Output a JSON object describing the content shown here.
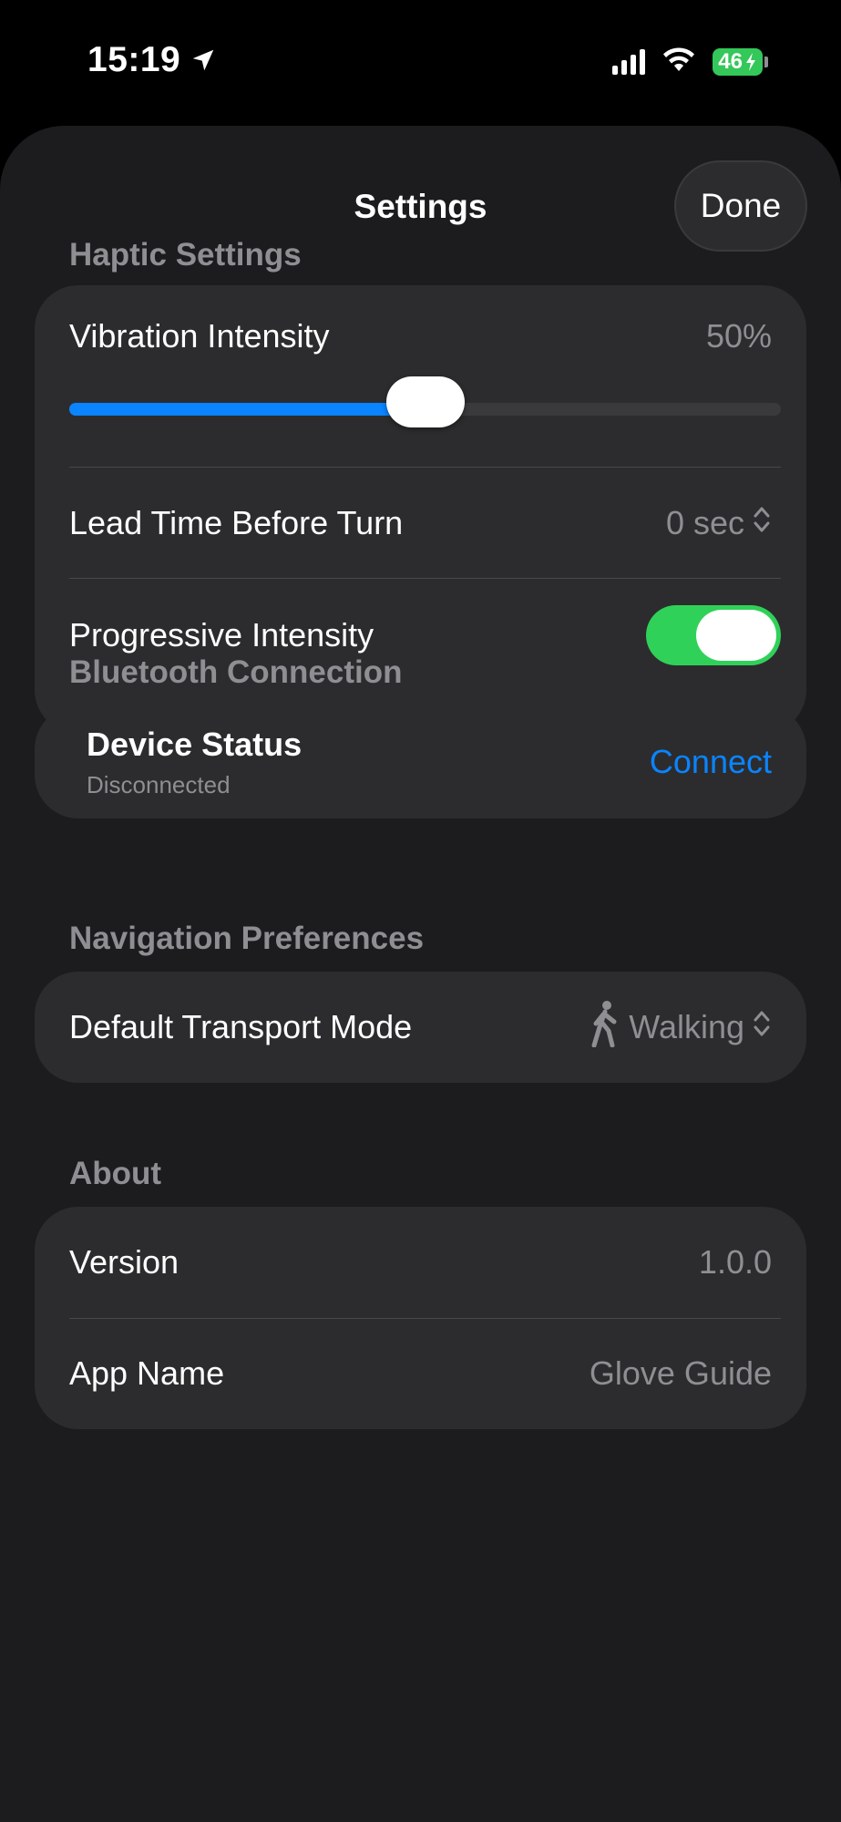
{
  "status_bar": {
    "time": "15:19",
    "battery": "46"
  },
  "header": {
    "title": "Settings",
    "done_label": "Done"
  },
  "haptic": {
    "section_label": "Haptic Settings",
    "vibration_label": "Vibration Intensity",
    "vibration_value": "50%",
    "vibration_fraction": 0.5,
    "lead_time_label": "Lead Time Before Turn",
    "lead_time_value": "0 sec",
    "progressive_label": "Progressive Intensity",
    "progressive_on": true
  },
  "bluetooth": {
    "section_label": "Bluetooth Connection",
    "device_title": "Device Status",
    "device_status": "Disconnected",
    "connect_label": "Connect"
  },
  "navigation": {
    "section_label": "Navigation Preferences",
    "transport_label": "Default Transport Mode",
    "transport_value": "Walking"
  },
  "about": {
    "section_label": "About",
    "version_label": "Version",
    "version_value": "1.0.0",
    "app_name_label": "App Name",
    "app_name_value": "Glove Guide"
  },
  "colors": {
    "accent": "#0a84ff",
    "toggle_on": "#30d158",
    "card_bg": "#2c2c2e",
    "sheet_bg": "#1c1c1e",
    "secondary_text": "#8e8e93"
  },
  "icons": [
    "location-arrow-icon",
    "cellular-signal-icon",
    "wifi-icon",
    "battery-charging-icon",
    "chevron-updown-icon",
    "walking-person-icon"
  ]
}
